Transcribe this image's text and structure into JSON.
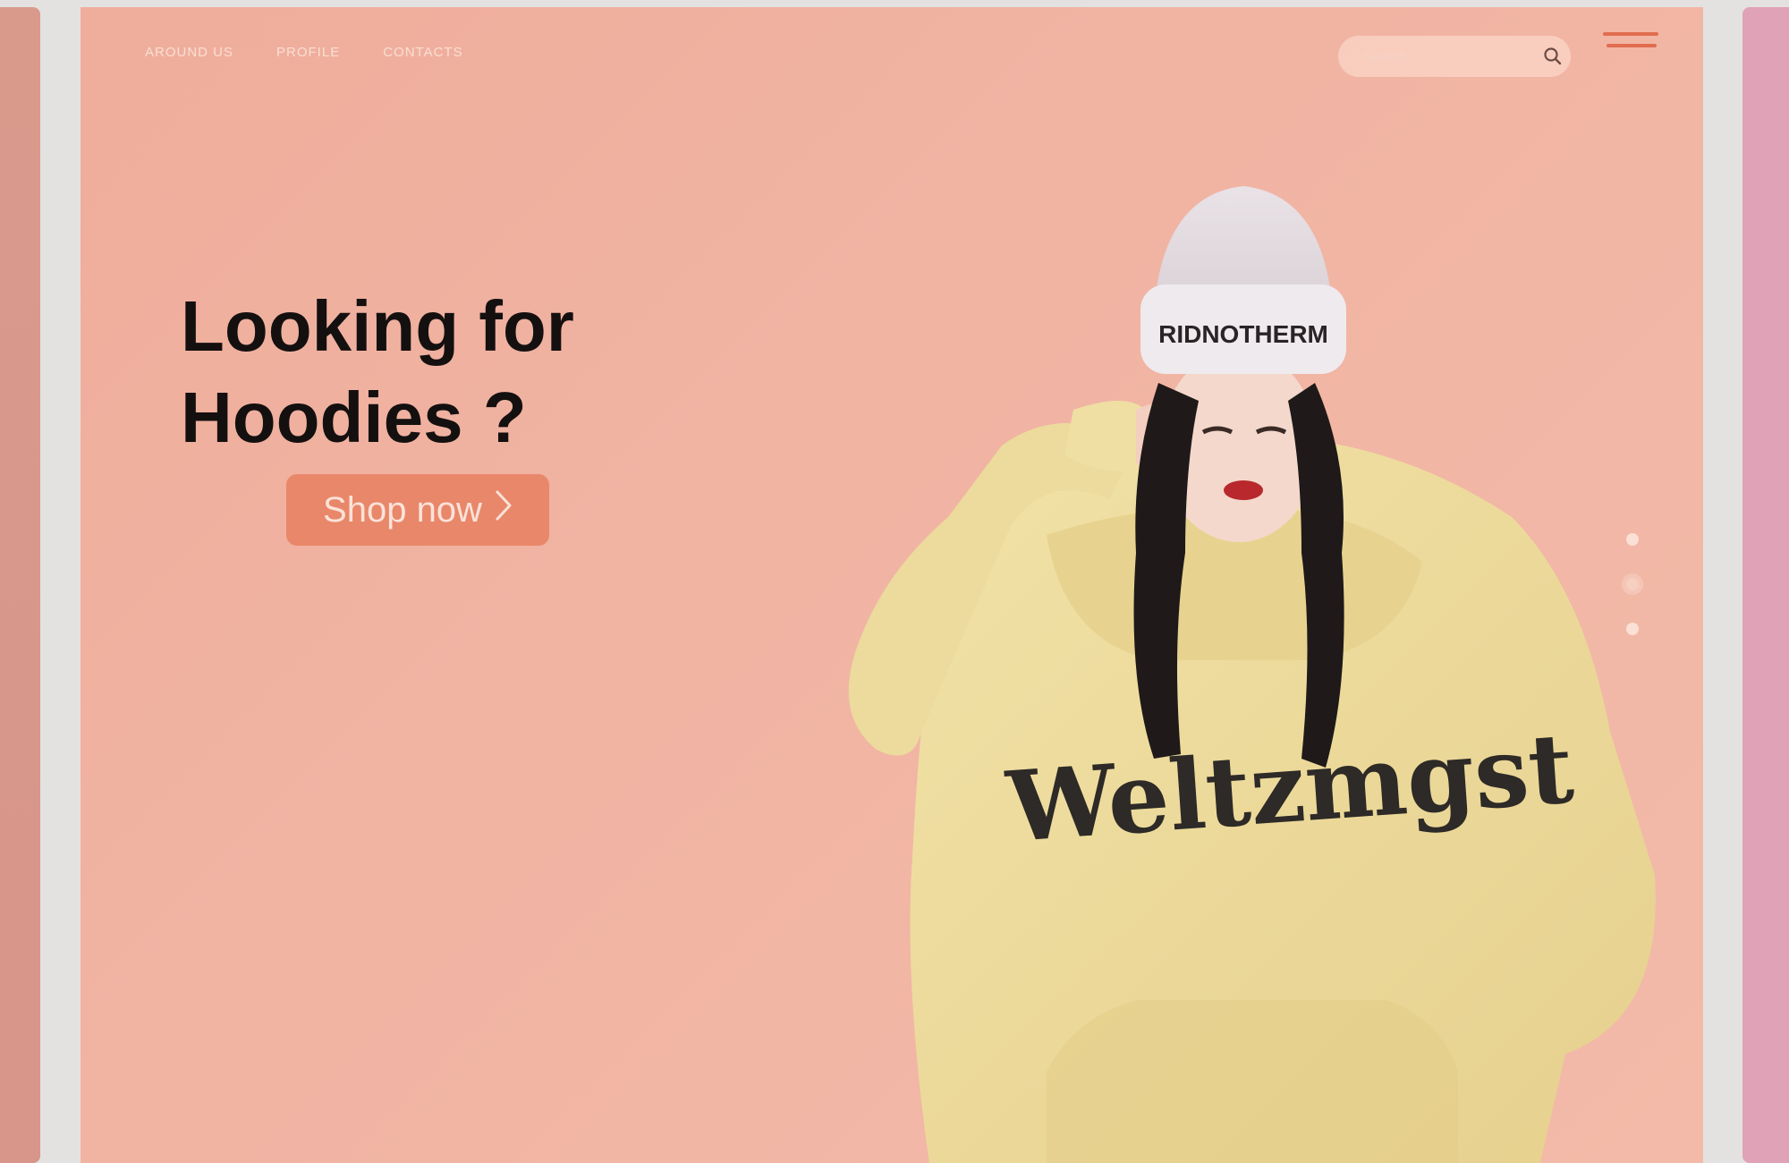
{
  "nav": {
    "links": [
      "AROUND US",
      "PROFILE",
      "CONTACTS"
    ]
  },
  "search": {
    "placeholder": "Search"
  },
  "hero": {
    "headline_line1": "Looking for",
    "headline_line2": "Hoodies ?",
    "cta_label": "Shop now"
  },
  "model": {
    "beanie_text": "RIDNOTHERM",
    "hoodie_text": "Weltzmgst"
  },
  "carousel": {
    "slides": 3,
    "active_index": 1
  },
  "colors": {
    "hero_bg": "#f1b4a3",
    "accent": "#e9876a",
    "menu_accent": "#e06d4f",
    "left_card": "#d99a8c",
    "right_card": "#dfa2b6"
  }
}
